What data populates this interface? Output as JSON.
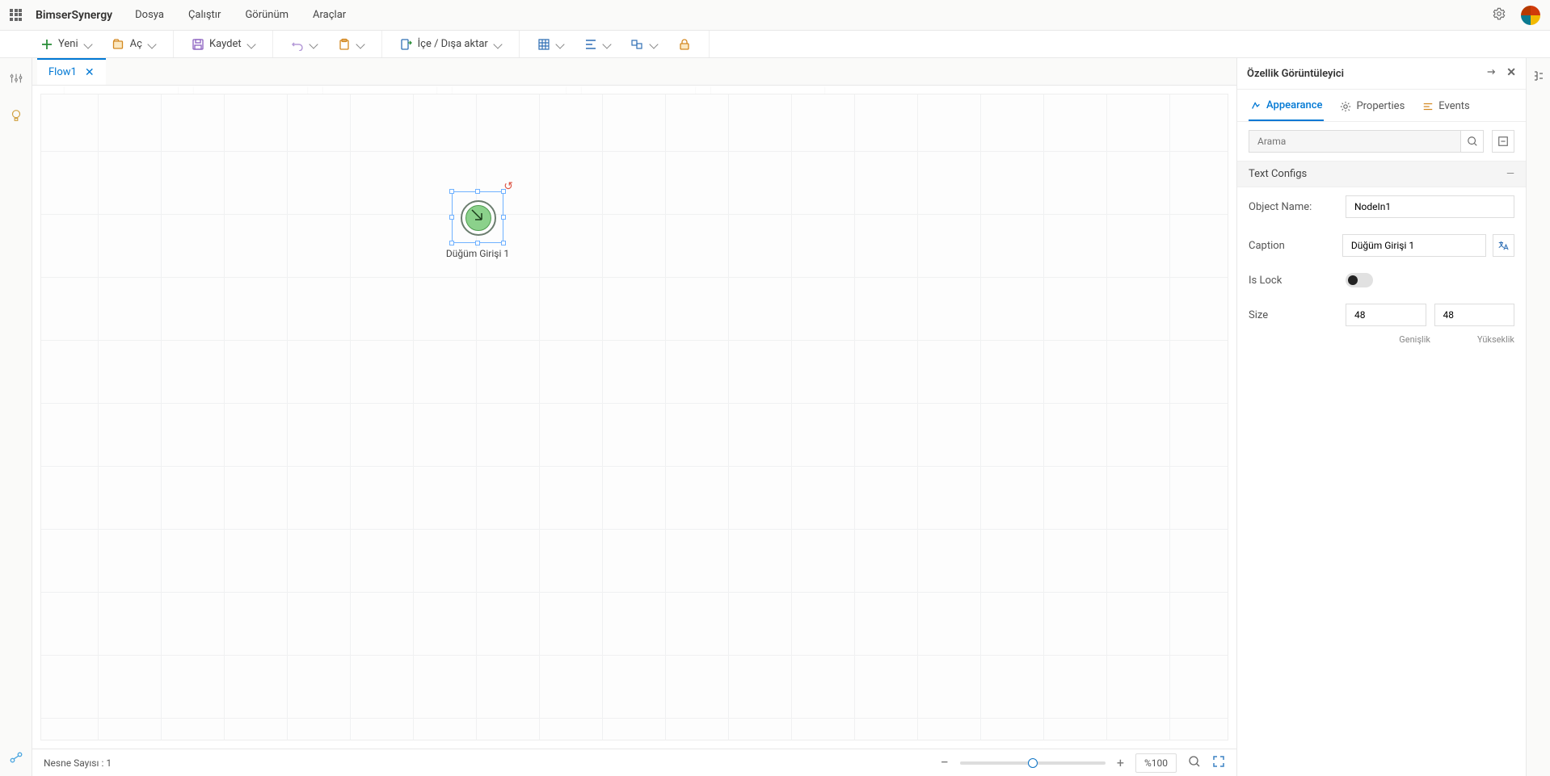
{
  "brand": "BimserSynergy",
  "menu": {
    "file": "Dosya",
    "run": "Çalıştır",
    "view": "Görünüm",
    "tools": "Araçlar"
  },
  "toolbar": {
    "new_label": "Yeni",
    "open_label": "Aç",
    "save_label": "Kaydet",
    "importexport_label": "İçe / Dışa aktar"
  },
  "tab": {
    "name": "Flow1"
  },
  "node": {
    "caption": "Düğüm Girişi 1"
  },
  "statusbar": {
    "object_count_label": "Nesne Sayısı :",
    "object_count_value": "1",
    "zoom": "%100"
  },
  "properties": {
    "panel_title": "Özellik Görüntüleyici",
    "tabs": {
      "appearance": "Appearance",
      "properties": "Properties",
      "events": "Events"
    },
    "search_placeholder": "Arama",
    "section1": "Text Configs",
    "labels": {
      "object_name": "Object Name:",
      "caption": "Caption",
      "is_lock": "Is Lock",
      "size": "Size",
      "width": "Genişlik",
      "height": "Yükseklik"
    },
    "values": {
      "object_name": "NodeIn1",
      "caption": "Düğüm Girişi 1",
      "width": "48",
      "height": "48"
    }
  }
}
